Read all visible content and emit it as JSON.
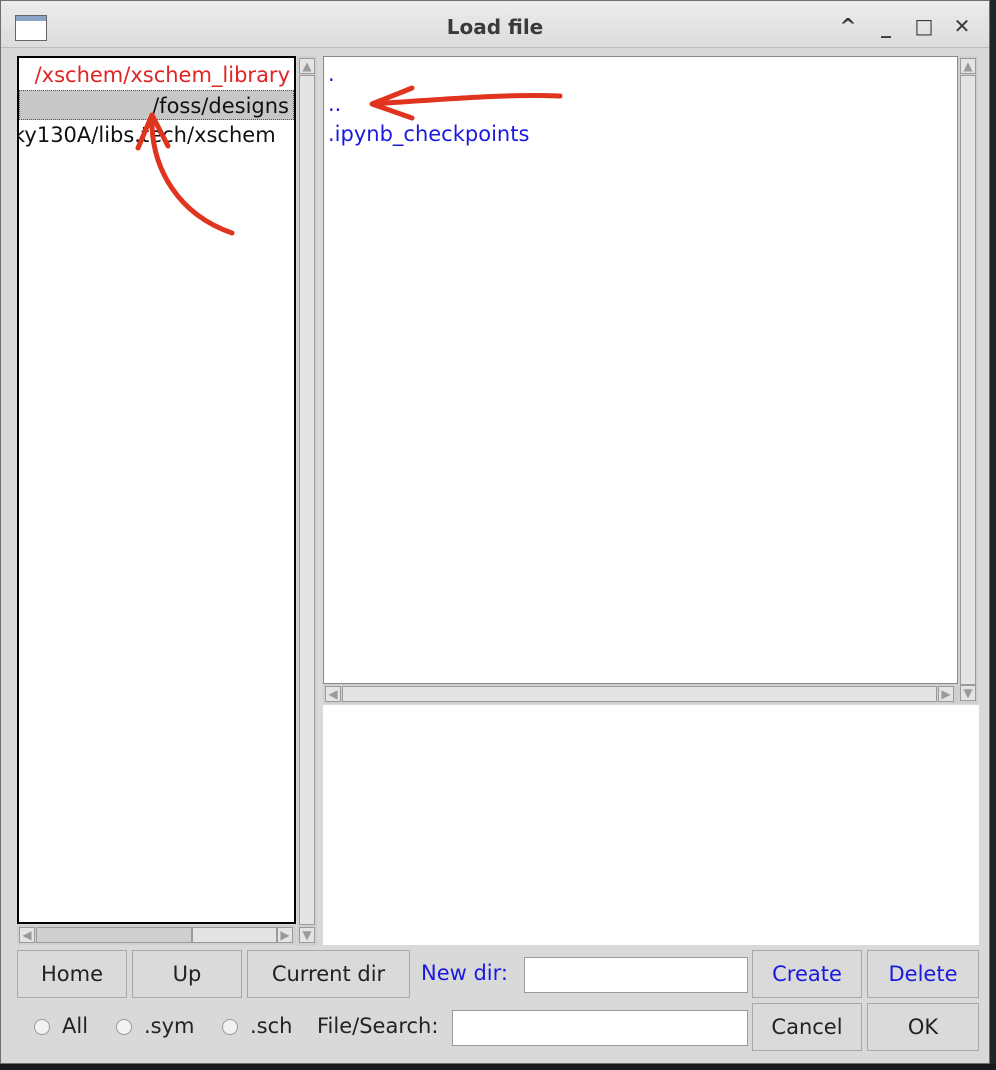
{
  "window": {
    "title": "Load file"
  },
  "titlebar_buttons": [
    "^",
    "_",
    "□",
    "✕"
  ],
  "dir_list": {
    "items": [
      {
        "text": "/xschem/xschem_library",
        "color": "#e02424"
      },
      {
        "text": "/foss/designs",
        "color": "#111111",
        "selected": true
      },
      {
        "text": "ky130A/libs.tech/xschem",
        "color": "#111111"
      }
    ]
  },
  "file_list": {
    "items": [
      ".",
      "..",
      ".ipynb_checkpoints"
    ]
  },
  "toolbar": {
    "home": "Home",
    "up": "Up",
    "current_dir": "Current dir",
    "new_dir_label": "New dir:",
    "create": "Create",
    "delete": "Delete",
    "cancel": "Cancel",
    "ok": "OK",
    "file_search_label": "File/Search:",
    "new_dir_value": "",
    "file_search_value": ""
  },
  "filters": [
    {
      "label": "All"
    },
    {
      "label": ".sym"
    },
    {
      "label": ".sch"
    }
  ],
  "colors": {
    "accent_blue": "#1a1adf",
    "annotation_red": "#e0341e"
  }
}
